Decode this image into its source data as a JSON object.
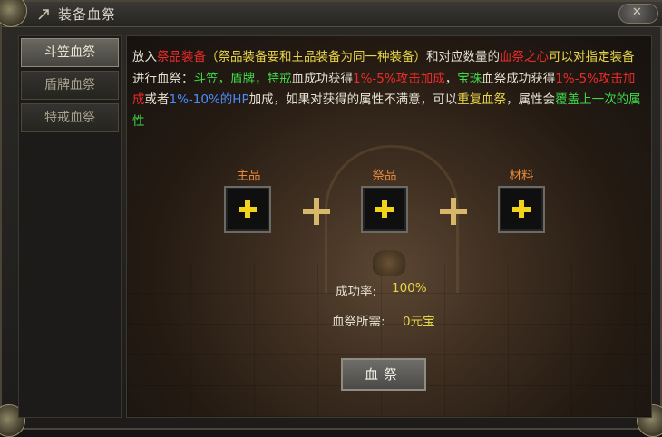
{
  "window": {
    "title": "装备血祭"
  },
  "sidebar": {
    "tabs": [
      {
        "label": "斗笠血祭",
        "active": true
      },
      {
        "label": "盾牌血祭",
        "active": false
      },
      {
        "label": "特戒血祭",
        "active": false
      }
    ]
  },
  "description": {
    "seg1": "放入",
    "seg2": "祭品装备",
    "seg3": "（祭品装备要和主品装备为同一种装备）",
    "seg4": "和对应数量的",
    "seg5": "血祭之心",
    "seg6": "可以对",
    "seg7": "指定装备",
    "seg8": "进行血祭：",
    "seg9": "斗笠，盾牌，特戒",
    "seg10": "血成功获得",
    "seg11": "1%-5%攻击加成",
    "seg12": "，",
    "seg13": "宝珠",
    "seg14": "血祭成功获得",
    "seg15": "1%-5%攻击加成",
    "seg16": "或者",
    "seg17": "1%-10%的HP",
    "seg18": "加成，如果对获得的属性不满意，可以",
    "seg19": "重复血祭",
    "seg20": "，属性会",
    "seg21": "覆盖上一次的属性"
  },
  "slots": {
    "main_label": "主品",
    "offering_label": "祭品",
    "material_label": "材料"
  },
  "stats": {
    "success_label": "成功率:",
    "success_value": "100%",
    "cost_label": "血祭所需:",
    "cost_value": "0元宝"
  },
  "action": {
    "label": "血祭"
  }
}
